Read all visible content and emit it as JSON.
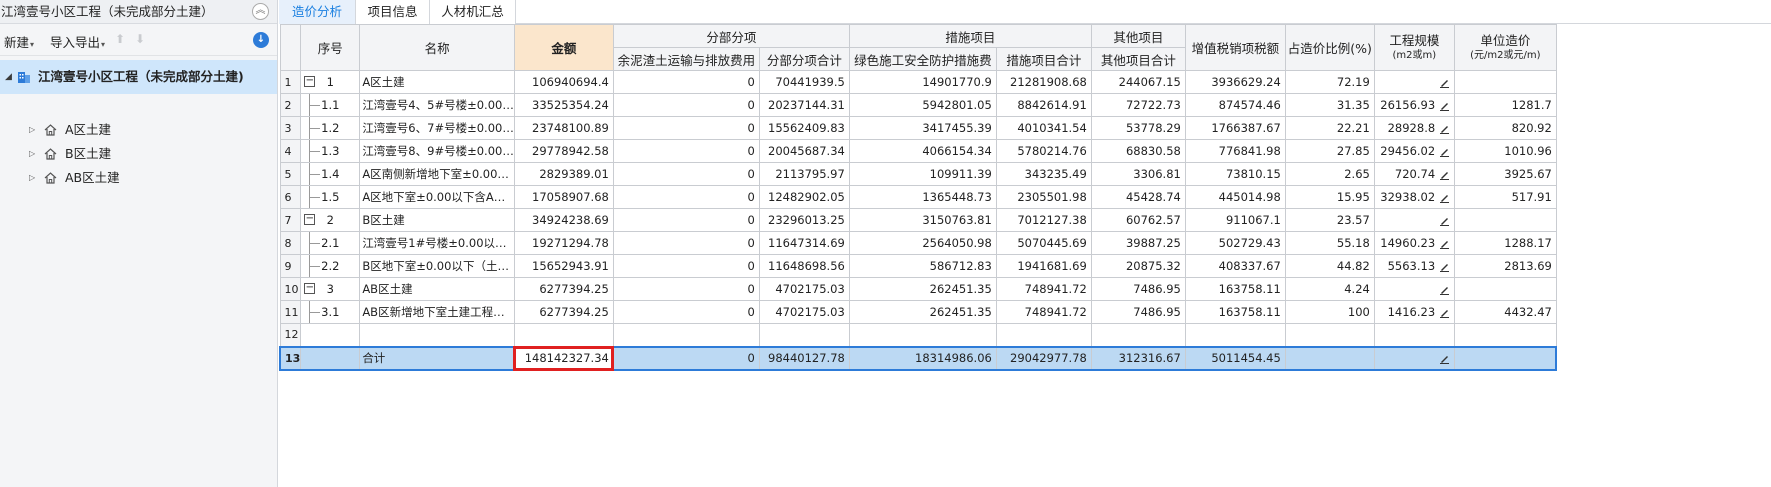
{
  "left_panel": {
    "title": "江湾壹号小区工程（未完成部分土建）",
    "toolbar": {
      "new_label": "新建",
      "import_export_label": "导入导出"
    },
    "tree": {
      "root_label": "江湾壹号小区工程（未完成部分土建)",
      "children": [
        {
          "label": "A区土建"
        },
        {
          "label": "B区土建"
        },
        {
          "label": "AB区土建"
        }
      ]
    }
  },
  "tabs": [
    {
      "label": "造价分析",
      "active": true
    },
    {
      "label": "项目信息",
      "active": false
    },
    {
      "label": "人材机汇总",
      "active": false
    }
  ],
  "grid": {
    "headers": {
      "seq": "序号",
      "name": "名称",
      "amount": "金额",
      "group_fbfx": "分部分项",
      "group_csxm": "措施项目",
      "group_qtxm": "其他项目",
      "col_transport": "余泥渣土运输与排放费用",
      "col_fbfx_total": "分部分项合计",
      "col_safety": "绿色施工安全防护措施费",
      "col_csxm_total": "措施项目合计",
      "col_qtxm_total": "其他项目合计",
      "col_vat": "增值税销项税额",
      "col_ratio": "占造价比例(%)",
      "col_scale": "工程规模",
      "col_scale_unit": "(m2或m)",
      "col_unit_cost": "单位造价",
      "col_unit_cost_unit": "(元/m2或元/m)"
    },
    "rows": [
      {
        "rn": "1",
        "seq": "1",
        "level": 0,
        "expand": "−",
        "name": "A区土建",
        "amount": "106940694.4",
        "transport": "0",
        "fbfx": "70441939.5",
        "safety": "14901770.9",
        "csxm": "21281908.68",
        "qtxm": "244067.15",
        "vat": "3936629.24",
        "ratio": "72.19",
        "scale": "",
        "unit": ""
      },
      {
        "rn": "2",
        "seq": "1.1",
        "level": 1,
        "expand": "",
        "name": "江湾壹号4、5#号楼±0.00…",
        "amount": "33525354.24",
        "transport": "0",
        "fbfx": "20237144.31",
        "safety": "5942801.05",
        "csxm": "8842614.91",
        "qtxm": "72722.73",
        "vat": "874574.46",
        "ratio": "31.35",
        "scale": "26156.93",
        "unit": "1281.7"
      },
      {
        "rn": "3",
        "seq": "1.2",
        "level": 1,
        "expand": "",
        "name": "江湾壹号6、7#号楼±0.00…",
        "amount": "23748100.89",
        "transport": "0",
        "fbfx": "15562409.83",
        "safety": "3417455.39",
        "csxm": "4010341.54",
        "qtxm": "53778.29",
        "vat": "1766387.67",
        "ratio": "22.21",
        "scale": "28928.8",
        "unit": "820.92"
      },
      {
        "rn": "4",
        "seq": "1.3",
        "level": 1,
        "expand": "",
        "name": "江湾壹号8、9#号楼±0.00…",
        "amount": "29778942.58",
        "transport": "0",
        "fbfx": "20045687.34",
        "safety": "4066154.34",
        "csxm": "5780214.76",
        "qtxm": "68830.58",
        "vat": "776841.98",
        "ratio": "27.85",
        "scale": "29456.02",
        "unit": "1010.96"
      },
      {
        "rn": "5",
        "seq": "1.4",
        "level": 1,
        "expand": "",
        "name": "A区南侧新增地下室±0.00…",
        "amount": "2829389.01",
        "transport": "0",
        "fbfx": "2113795.97",
        "safety": "109911.39",
        "csxm": "343235.49",
        "qtxm": "3306.81",
        "vat": "73810.15",
        "ratio": "2.65",
        "scale": "720.74",
        "unit": "3925.67"
      },
      {
        "rn": "6",
        "seq": "1.5",
        "level": 1,
        "expand": "",
        "name": "A区地下室±0.00以下含A…",
        "amount": "17058907.68",
        "transport": "0",
        "fbfx": "12482902.05",
        "safety": "1365448.73",
        "csxm": "2305501.98",
        "qtxm": "45428.74",
        "vat": "445014.98",
        "ratio": "15.95",
        "scale": "32938.02",
        "unit": "517.91"
      },
      {
        "rn": "7",
        "seq": "2",
        "level": 0,
        "expand": "−",
        "name": "B区土建",
        "amount": "34924238.69",
        "transport": "0",
        "fbfx": "23296013.25",
        "safety": "3150763.81",
        "csxm": "7012127.38",
        "qtxm": "60762.57",
        "vat": "911067.1",
        "ratio": "23.57",
        "scale": "",
        "unit": ""
      },
      {
        "rn": "8",
        "seq": "2.1",
        "level": 1,
        "expand": "",
        "name": "江湾壹号1#号楼±0.00以…",
        "amount": "19271294.78",
        "transport": "0",
        "fbfx": "11647314.69",
        "safety": "2564050.98",
        "csxm": "5070445.69",
        "qtxm": "39887.25",
        "vat": "502729.43",
        "ratio": "55.18",
        "scale": "14960.23",
        "unit": "1288.17"
      },
      {
        "rn": "9",
        "seq": "2.2",
        "level": 1,
        "expand": "",
        "name": "B区地下室±0.00以下（土…",
        "amount": "15652943.91",
        "transport": "0",
        "fbfx": "11648698.56",
        "safety": "586712.83",
        "csxm": "1941681.69",
        "qtxm": "20875.32",
        "vat": "408337.67",
        "ratio": "44.82",
        "scale": "5563.13",
        "unit": "2813.69"
      },
      {
        "rn": "10",
        "seq": "3",
        "level": 0,
        "expand": "−",
        "name": "AB区土建",
        "amount": "6277394.25",
        "transport": "0",
        "fbfx": "4702175.03",
        "safety": "262451.35",
        "csxm": "748941.72",
        "qtxm": "7486.95",
        "vat": "163758.11",
        "ratio": "4.24",
        "scale": "",
        "unit": ""
      },
      {
        "rn": "11",
        "seq": "3.1",
        "level": 1,
        "expand": "",
        "name": "AB区新增地下室土建工程…",
        "amount": "6277394.25",
        "transport": "0",
        "fbfx": "4702175.03",
        "safety": "262451.35",
        "csxm": "748941.72",
        "qtxm": "7486.95",
        "vat": "163758.11",
        "ratio": "100",
        "scale": "1416.23",
        "unit": "4432.47"
      },
      {
        "rn": "12",
        "seq": "",
        "level": -1,
        "expand": "",
        "name": "",
        "amount": "",
        "transport": "",
        "fbfx": "",
        "safety": "",
        "csxm": "",
        "qtxm": "",
        "vat": "",
        "ratio": "",
        "scale": "",
        "unit": ""
      }
    ],
    "total_row": {
      "rn": "13",
      "name": "合计",
      "amount": "148142327.34",
      "transport": "0",
      "fbfx": "98440127.78",
      "safety": "18314986.06",
      "csxm": "29042977.78",
      "qtxm": "312316.67",
      "vat": "5011454.45"
    }
  }
}
